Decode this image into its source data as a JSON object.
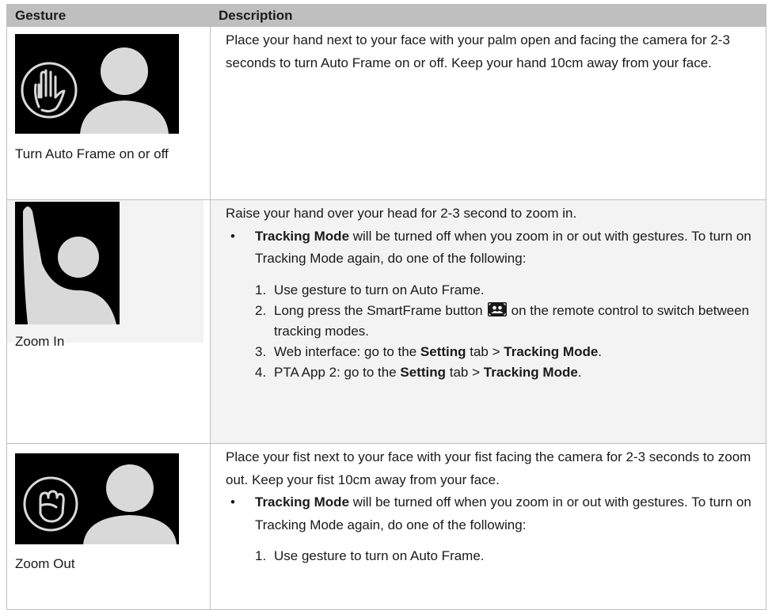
{
  "table": {
    "headers": [
      "Gesture",
      "Description"
    ],
    "rows": [
      {
        "caption": "Turn Auto Frame on or off",
        "icon": "open-palm-icon",
        "description": "Place your hand next to your face with your palm open and facing the camera for 2-3 seconds to turn Auto Frame on or off. Keep your hand 10cm away from your face."
      },
      {
        "caption": "Zoom In",
        "icon": "raised-hand-icon",
        "description": "Raise your hand over your head for 2-3 second to zoom in.",
        "bullet_bold": "Tracking Mode",
        "bullet_text": " will be turned off when you zoom in or out with gestures. To turn on Tracking Mode again, do one of the following:",
        "steps": [
          {
            "num": "1.",
            "text": "Use gesture to turn on Auto Frame."
          },
          {
            "num": "2.",
            "pre": "Long press the SmartFrame button",
            "icon": "smartframe-icon",
            "post": "on the remote control to switch between tracking modes."
          },
          {
            "num": "3.",
            "pre": "Web interface: go to the ",
            "b1": "Setting",
            "mid": " tab > ",
            "b2": "Tracking Mode",
            "post": "."
          },
          {
            "num": "4.",
            "pre": "PTA App 2: go to the ",
            "b1": "Setting",
            "mid": " tab > ",
            "b2": "Tracking Mode",
            "post": "."
          }
        ]
      },
      {
        "caption": "Zoom Out",
        "icon": "fist-icon",
        "description": "Place your fist next to your face with your fist facing the camera for 2-3 seconds to zoom out. Keep your fist 10cm away from your face.",
        "bullet_bold": "Tracking Mode",
        "bullet_text": " will be turned off when you zoom in or out with gestures. To turn on Tracking Mode again, do one of the following:",
        "steps": [
          {
            "num": "1.",
            "text": "Use gesture to turn on Auto Frame."
          }
        ]
      }
    ]
  }
}
